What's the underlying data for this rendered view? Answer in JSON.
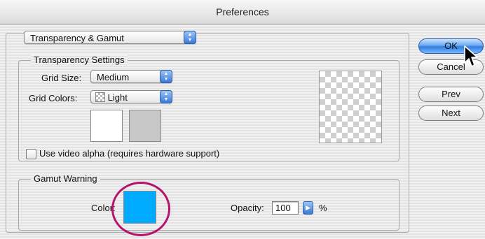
{
  "window": {
    "title": "Preferences"
  },
  "section_popup": {
    "value": "Transparency & Gamut"
  },
  "transparency": {
    "legend": "Transparency Settings",
    "grid_size_label": "Grid Size:",
    "grid_size_value": "Medium",
    "grid_colors_label": "Grid Colors:",
    "grid_colors_value": "Light",
    "video_alpha_label": "Use video alpha (requires hardware support)",
    "video_alpha_checked": false
  },
  "gamut": {
    "legend": "Gamut Warning",
    "color_label": "Color:",
    "color_value": "#00aaff",
    "opacity_label": "Opacity:",
    "opacity_value": "100",
    "opacity_unit": "%"
  },
  "buttons": {
    "ok": "OK",
    "cancel": "Cancel",
    "prev": "Prev",
    "next": "Next"
  },
  "colors": {
    "highlight": "#b5146e",
    "gamut_swatch": "#00aaff",
    "light_swatch_1": "#ffffff",
    "light_swatch_2": "#c8c8c8"
  }
}
